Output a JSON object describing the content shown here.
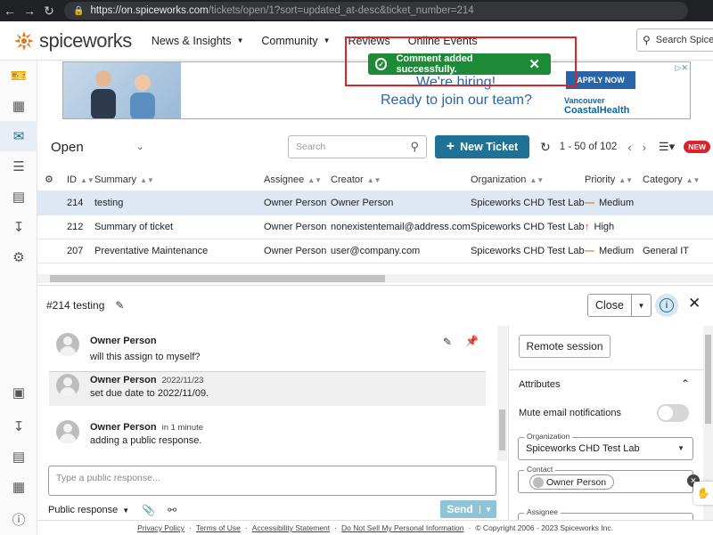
{
  "browser": {
    "url_host": "https://on.spiceworks.com",
    "url_path": "/tickets/open/1?sort=updated_at-desc&ticket_number=214"
  },
  "nav": {
    "logo_text": "spiceworks",
    "items": [
      "News & Insights",
      "Community",
      "Reviews",
      "Online Events"
    ],
    "search_placeholder": "Search Spiceworks"
  },
  "banner": {
    "headline": "We're hiring!",
    "subline": "Ready to join our team?",
    "apply_label": "APPLY NOW",
    "brand_line1": "Vancouver",
    "brand_line2": "CoastalHealth"
  },
  "toast": {
    "message": "Comment added successfully.",
    "color": "#1e8a37"
  },
  "list": {
    "view_name": "Open",
    "search_placeholder": "Search",
    "new_ticket_label": "New Ticket",
    "page_info": "1 - 50 of 102",
    "new_badge": "NEW",
    "columns": [
      "ID",
      "Summary",
      "Assignee",
      "Creator",
      "Organization",
      "Priority",
      "Category"
    ],
    "rows": [
      {
        "id": "214",
        "summary": "testing",
        "assignee": "Owner Person",
        "creator": "Owner Person",
        "organization": "Spiceworks CHD Test Lab",
        "priority": "Medium",
        "priority_icon": "dash",
        "category": ""
      },
      {
        "id": "212",
        "summary": "Summary of ticket",
        "assignee": "Owner Person",
        "creator": "nonexistentemail@address.com",
        "organization": "Spiceworks CHD Test Lab",
        "priority": "High",
        "priority_icon": "arrow-up",
        "category": ""
      },
      {
        "id": "207",
        "summary": "Preventative Maintenance",
        "assignee": "Owner Person",
        "creator": "user@company.com",
        "organization": "Spiceworks CHD Test Lab",
        "priority": "Medium",
        "priority_icon": "dash",
        "category": "General IT"
      }
    ]
  },
  "detail": {
    "title": "#214 testing",
    "close_label": "Close",
    "comments": [
      {
        "author": "Owner Person",
        "meta": "",
        "text": "will this assign to myself?"
      },
      {
        "author": "Owner Person",
        "meta": "2022/11/23",
        "text": "set due date to ",
        "text_bold": "2022/11/09."
      },
      {
        "author": "Owner Person",
        "meta": "in 1 minute",
        "text": "adding a public response."
      }
    ],
    "reply_placeholder": "Type a public response...",
    "reply_mode": "Public response",
    "send_label": "Send"
  },
  "sidebar": {
    "remote_session_label": "Remote session",
    "attributes_title": "Attributes",
    "mute_label": "Mute email notifications",
    "org_label": "Organization",
    "org_value": "Spiceworks CHD Test Lab",
    "contact_label": "Contact",
    "contact_value": "Owner Person",
    "assignee_label": "Assignee"
  },
  "footer": {
    "links": [
      "Privacy Policy",
      "Terms of Use",
      "Accessibility Statement",
      "Do Not Sell My Personal Information"
    ],
    "copyright": "© Copyright 2006 - 2023 Spiceworks Inc."
  },
  "colors": {
    "primary": "#1d7296",
    "priority_medium": "#e2761b",
    "priority_high": "#d9232d",
    "selected_row": "#dde8f4"
  }
}
